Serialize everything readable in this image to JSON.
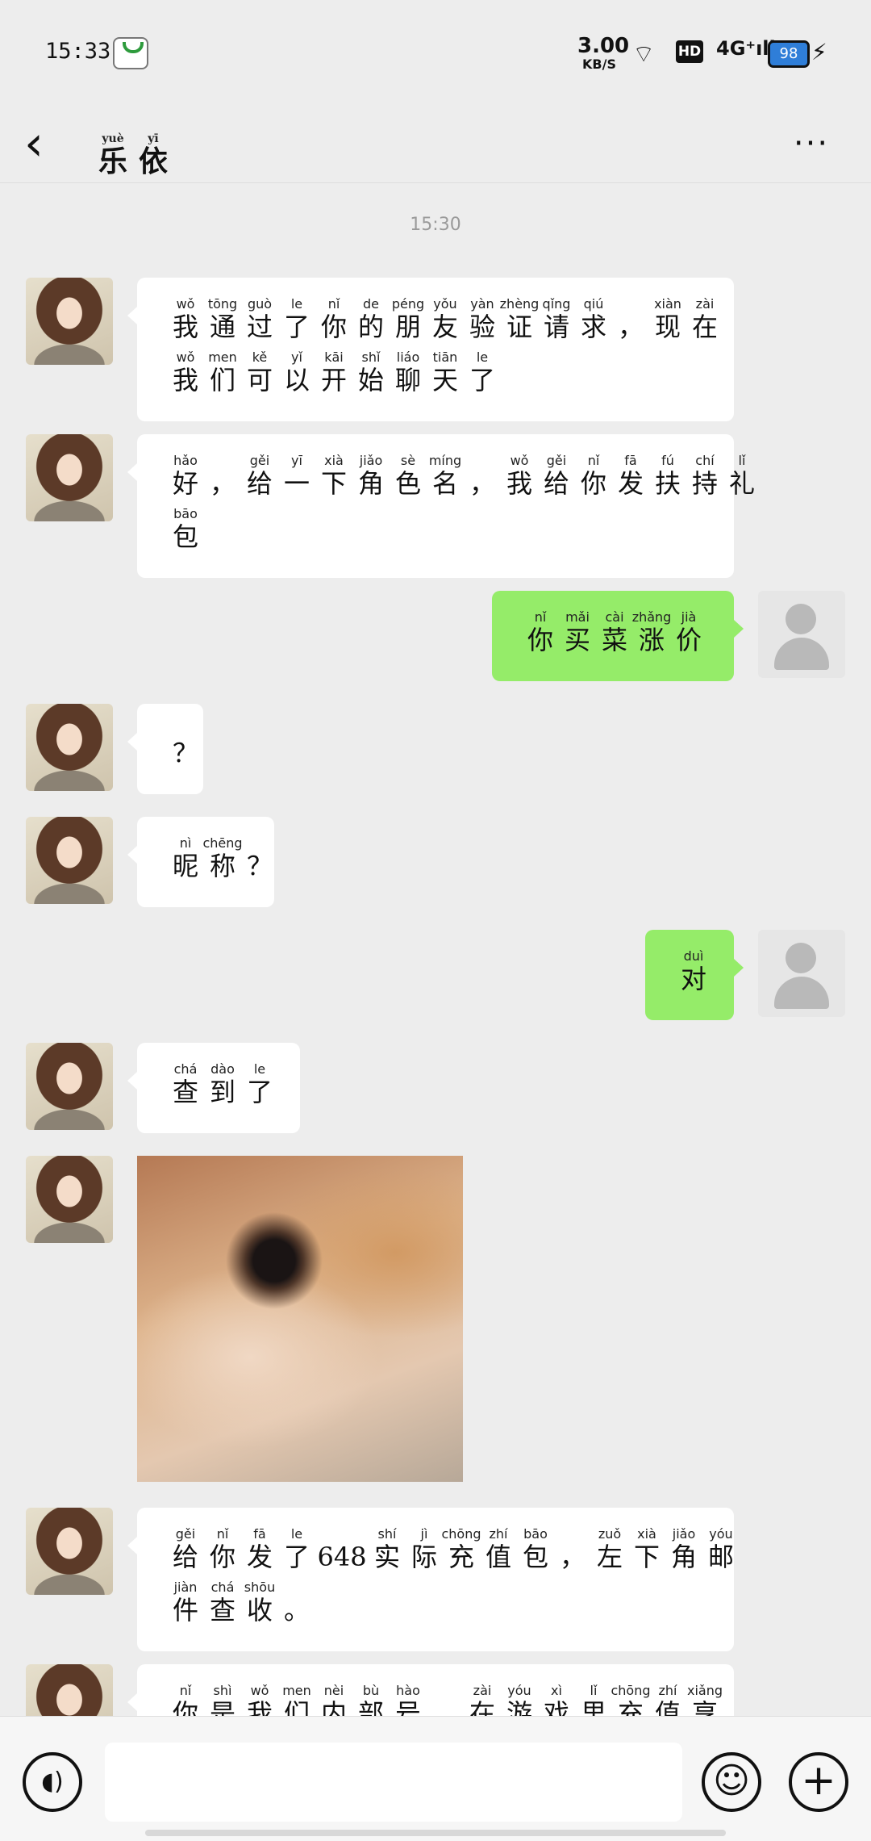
{
  "status_bar": {
    "time": "15:33",
    "net_speed": "3.00",
    "net_speed_unit": "KB/S",
    "hd_label": "HD",
    "signal_label": "4G⁺ıll",
    "battery": "98",
    "icons": [
      "app-notification-icon",
      "wifi-icon",
      "signal-icon",
      "battery-icon",
      "charging-icon"
    ]
  },
  "header": {
    "title": "乐依",
    "back_icon": "chevron-left-icon",
    "more_label": "···"
  },
  "chat": {
    "timestamp": "15:30",
    "messages": [
      {
        "from": "other",
        "type": "text",
        "lines": [
          [
            [
              "wǒ",
              "我"
            ],
            [
              "tōng",
              "通"
            ],
            [
              "guò",
              "过"
            ],
            [
              "le",
              "了"
            ],
            [
              "nǐ",
              "你"
            ],
            [
              "de",
              "的"
            ],
            [
              "péng",
              "朋"
            ],
            [
              "yǒu",
              "友"
            ],
            [
              "yàn",
              "验"
            ],
            [
              "zhèng",
              "证"
            ],
            [
              "qǐng",
              "请"
            ],
            [
              "qiú",
              "求"
            ],
            [
              "",
              "，"
            ],
            [
              "xiàn",
              "现"
            ],
            [
              "zài",
              "在"
            ]
          ],
          [
            [
              "wǒ",
              "我"
            ],
            [
              "men",
              "们"
            ],
            [
              "kě",
              "可"
            ],
            [
              "yǐ",
              "以"
            ],
            [
              "kāi",
              "开"
            ],
            [
              "shǐ",
              "始"
            ],
            [
              "liáo",
              "聊"
            ],
            [
              "tiān",
              "天"
            ],
            [
              "le",
              "了"
            ]
          ]
        ]
      },
      {
        "from": "other",
        "type": "text",
        "lines": [
          [
            [
              "hǎo",
              "好"
            ],
            [
              "",
              "，"
            ],
            [
              "gěi",
              "给"
            ],
            [
              "yī",
              "一"
            ],
            [
              "xià",
              "下"
            ],
            [
              "jiǎo",
              "角"
            ],
            [
              "sè",
              "色"
            ],
            [
              "míng",
              "名"
            ],
            [
              "",
              "，"
            ],
            [
              "wǒ",
              "我"
            ],
            [
              "gěi",
              "给"
            ],
            [
              "nǐ",
              "你"
            ],
            [
              "fā",
              "发"
            ],
            [
              "fú",
              "扶"
            ],
            [
              "chí",
              "持"
            ],
            [
              "lǐ",
              "礼"
            ]
          ],
          [
            [
              "bāo",
              "包"
            ]
          ]
        ]
      },
      {
        "from": "me",
        "type": "text",
        "lines": [
          [
            [
              "nǐ",
              "你"
            ],
            [
              "mǎi",
              "买"
            ],
            [
              "cài",
              "菜"
            ],
            [
              "zhǎng",
              "涨"
            ],
            [
              "jià",
              "价"
            ]
          ]
        ]
      },
      {
        "from": "other",
        "type": "text",
        "lines": [
          [
            [
              "",
              "？"
            ]
          ]
        ]
      },
      {
        "from": "other",
        "type": "text",
        "lines": [
          [
            [
              "nì",
              "昵"
            ],
            [
              "chēng",
              "称"
            ],
            [
              "",
              "？"
            ]
          ]
        ]
      },
      {
        "from": "me",
        "type": "text",
        "lines": [
          [
            [
              "duì",
              "对"
            ]
          ]
        ]
      },
      {
        "from": "other",
        "type": "text",
        "lines": [
          [
            [
              "chá",
              "查"
            ],
            [
              "dào",
              "到"
            ],
            [
              "le",
              "了"
            ]
          ]
        ]
      },
      {
        "from": "other",
        "type": "image",
        "description": "blurry close-up photo"
      },
      {
        "from": "other",
        "type": "text",
        "lines": [
          [
            [
              "gěi",
              "给"
            ],
            [
              "nǐ",
              "你"
            ],
            [
              "fā",
              "发"
            ],
            [
              "le",
              "了"
            ],
            [
              "",
              "648"
            ],
            [
              "shí",
              "实"
            ],
            [
              "jì",
              "际"
            ],
            [
              "chōng",
              "充"
            ],
            [
              "zhí",
              "值"
            ],
            [
              "bāo",
              "包"
            ],
            [
              "",
              "，"
            ],
            [
              "zuǒ",
              "左"
            ],
            [
              "xià",
              "下"
            ],
            [
              "jiǎo",
              "角"
            ],
            [
              "yóu",
              "邮"
            ]
          ],
          [
            [
              "jiàn",
              "件"
            ],
            [
              "chá",
              "查"
            ],
            [
              "shōu",
              "收"
            ],
            [
              "",
              "。"
            ]
          ]
        ]
      },
      {
        "from": "other",
        "type": "text",
        "lines": [
          [
            [
              "nǐ",
              "你"
            ],
            [
              "shì",
              "是"
            ],
            [
              "wǒ",
              "我"
            ],
            [
              "men",
              "们"
            ],
            [
              "nèi",
              "内"
            ],
            [
              "bù",
              "部"
            ],
            [
              "hào",
              "号"
            ],
            [
              "",
              "，"
            ],
            [
              "zài",
              "在"
            ],
            [
              "yóu",
              "游"
            ],
            [
              "xì",
              "戏"
            ],
            [
              "lǐ",
              "里"
            ],
            [
              "chōng",
              "充"
            ],
            [
              "zhí",
              "值"
            ],
            [
              "xiǎng",
              "享"
            ]
          ]
        ]
      }
    ]
  },
  "input_bar": {
    "voice_icon": "voice-icon",
    "input_value": "",
    "emoji_icon": "emoji-icon",
    "plus_icon": "plus-icon"
  }
}
